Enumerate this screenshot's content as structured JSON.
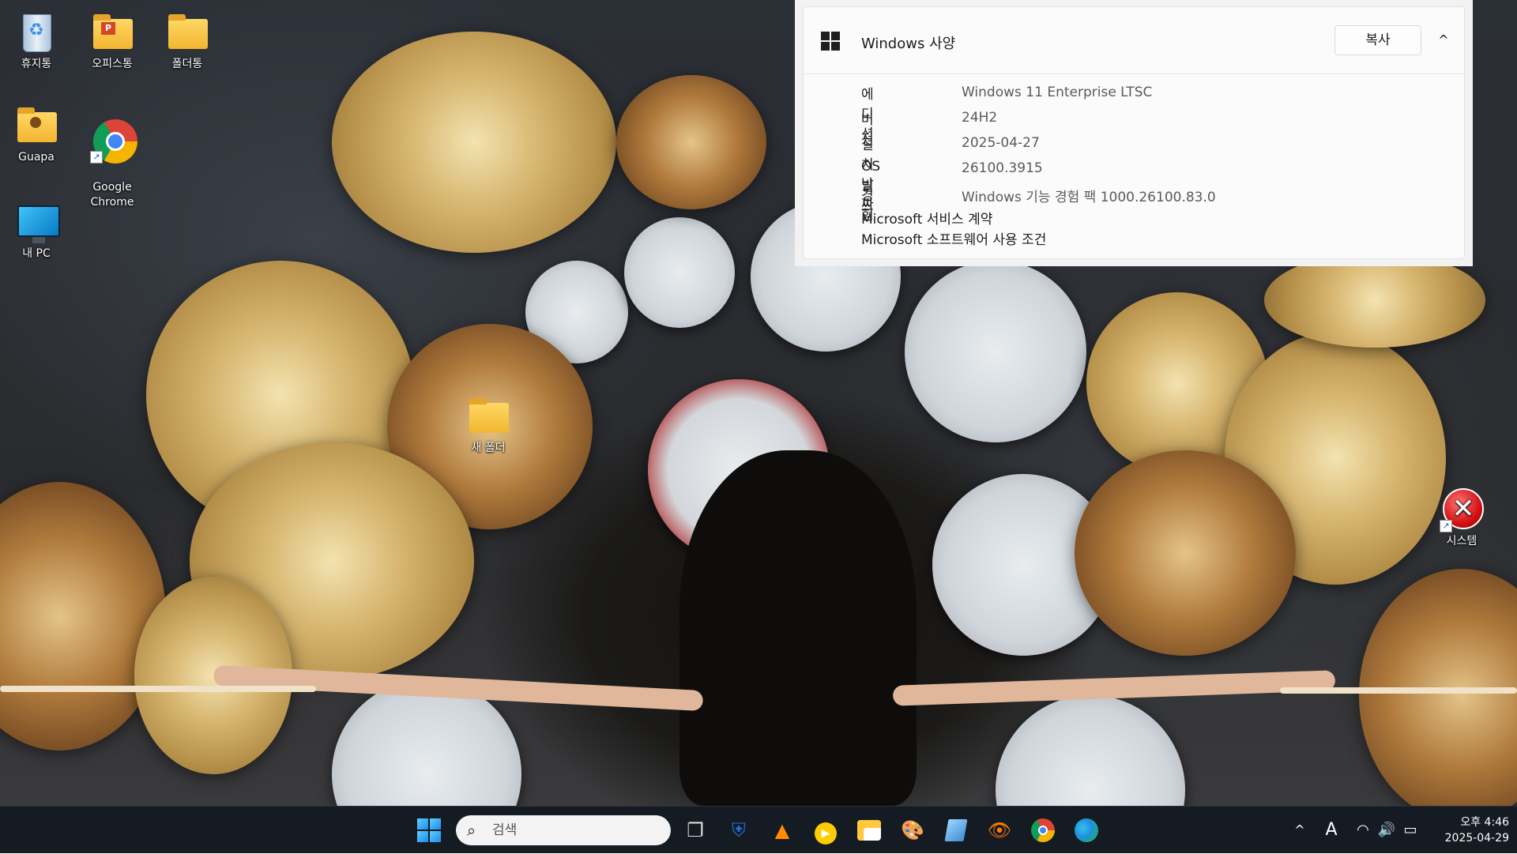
{
  "desktop": {
    "icons": [
      {
        "label": "휴지통"
      },
      {
        "label": "오피스통"
      },
      {
        "label": "폴더통"
      },
      {
        "label": "Guapa"
      },
      {
        "label": "Google\nChrome"
      },
      {
        "label": "내 PC"
      },
      {
        "label": "새 폴더"
      },
      {
        "label": "시스템"
      }
    ]
  },
  "spec_panel": {
    "title": "Windows 사양",
    "copy_label": "복사",
    "collapse_icon": "^",
    "rows": [
      {
        "label": "에디션",
        "value": "Windows 11 Enterprise LTSC"
      },
      {
        "label": "버전",
        "value": "24H2"
      },
      {
        "label": "설치 날짜",
        "value": "2025-04-27"
      },
      {
        "label": "OS 빌드",
        "value": "26100.3915"
      },
      {
        "label": "경험",
        "value": "Windows 기능 경험 팩 1000.26100.83.0"
      }
    ],
    "links": [
      "Microsoft 서비스 계약",
      "Microsoft 소프트웨어 사용 조건"
    ]
  },
  "taskbar": {
    "search_placeholder": "검색",
    "apps": [
      "task-view",
      "windows-security",
      "vlc",
      "media-player",
      "file-explorer",
      "paint",
      "notepad",
      "eye-app",
      "google-chrome",
      "microsoft-edge"
    ],
    "tray": {
      "chevron": "^",
      "ime": "A",
      "time": "오후 4:46",
      "date": "2025-04-29"
    }
  }
}
